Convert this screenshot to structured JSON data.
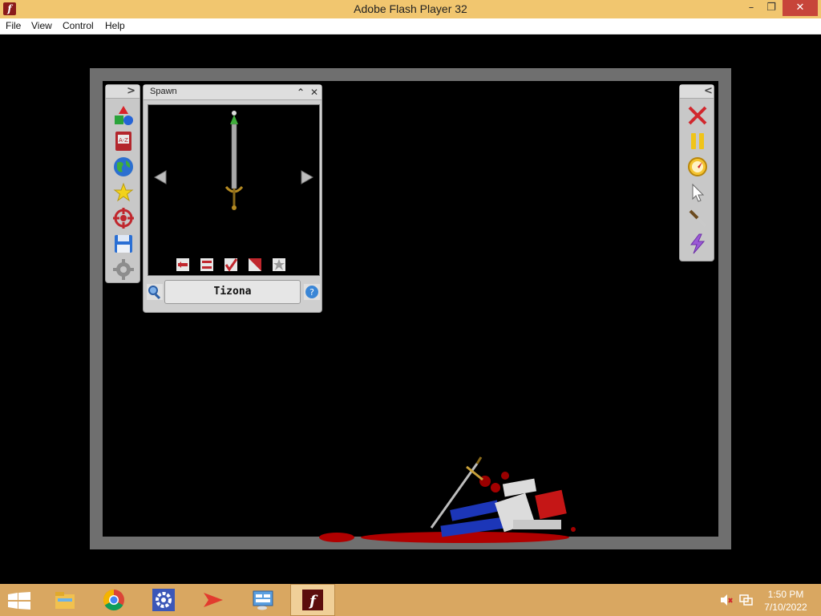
{
  "window": {
    "title": "Adobe Flash Player 32",
    "app_icon_glyph": "f",
    "min_glyph": "–",
    "max_glyph": "❐",
    "close_glyph": "✕"
  },
  "menu": {
    "items": [
      "File",
      "View",
      "Control",
      "Help"
    ]
  },
  "left_toolbar": {
    "collapse_glyph": ">",
    "tools": [
      "shapes-icon",
      "a-z-icon",
      "globe-icon",
      "star-icon",
      "target-icon",
      "save-icon",
      "settings-icon"
    ]
  },
  "spawn_panel": {
    "title": "Spawn",
    "minimize_glyph": "⌃",
    "close_glyph": "✕",
    "selected_item": "Tizona",
    "small_tools": [
      "flip-icon",
      "swap-icon",
      "check-icon",
      "no-collide-icon",
      "explode-icon"
    ]
  },
  "right_toolbar": {
    "collapse_glyph": "<",
    "tools": [
      "delete-icon",
      "pause-icon",
      "compass-icon",
      "cursor-icon",
      "knife-icon",
      "lightning-icon"
    ]
  },
  "taskbar": {
    "apps": [
      "file-explorer-icon",
      "chrome-icon",
      "settings-app-icon",
      "arrow-app-icon",
      "control-panel-icon",
      "flash-player-icon"
    ],
    "active_app": "flash-player-icon",
    "time": "1:50 PM",
    "date": "7/10/2022"
  },
  "colors": {
    "titlebar": "#f1c66f",
    "taskbar": "#d9a761",
    "stage_frame": "#6f6f6f",
    "blood": "#b00000",
    "ragdoll_blue": "#1c36b8",
    "ragdoll_skin": "#dcdcdc"
  }
}
